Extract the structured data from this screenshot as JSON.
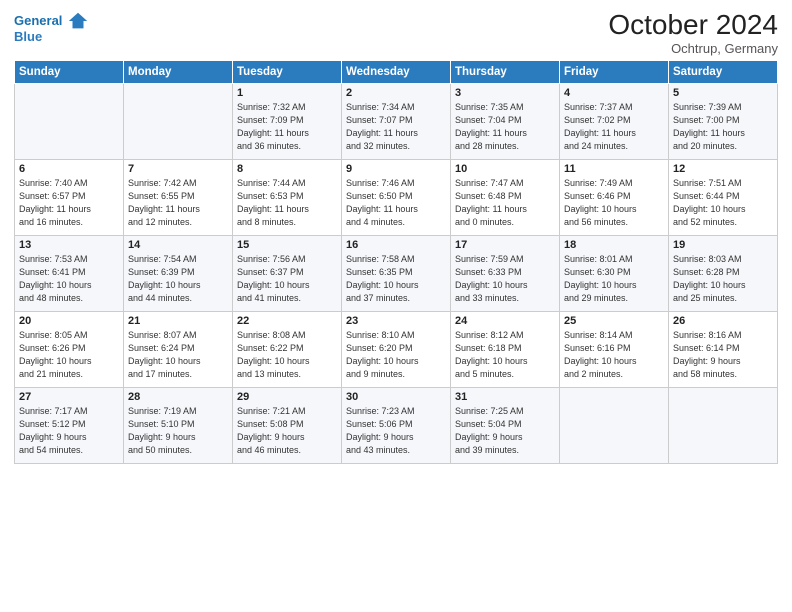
{
  "header": {
    "logo_line1": "General",
    "logo_line2": "Blue",
    "month": "October 2024",
    "location": "Ochtrup, Germany"
  },
  "days_of_week": [
    "Sunday",
    "Monday",
    "Tuesday",
    "Wednesday",
    "Thursday",
    "Friday",
    "Saturday"
  ],
  "weeks": [
    [
      {
        "day": "",
        "text": ""
      },
      {
        "day": "",
        "text": ""
      },
      {
        "day": "1",
        "text": "Sunrise: 7:32 AM\nSunset: 7:09 PM\nDaylight: 11 hours\nand 36 minutes."
      },
      {
        "day": "2",
        "text": "Sunrise: 7:34 AM\nSunset: 7:07 PM\nDaylight: 11 hours\nand 32 minutes."
      },
      {
        "day": "3",
        "text": "Sunrise: 7:35 AM\nSunset: 7:04 PM\nDaylight: 11 hours\nand 28 minutes."
      },
      {
        "day": "4",
        "text": "Sunrise: 7:37 AM\nSunset: 7:02 PM\nDaylight: 11 hours\nand 24 minutes."
      },
      {
        "day": "5",
        "text": "Sunrise: 7:39 AM\nSunset: 7:00 PM\nDaylight: 11 hours\nand 20 minutes."
      }
    ],
    [
      {
        "day": "6",
        "text": "Sunrise: 7:40 AM\nSunset: 6:57 PM\nDaylight: 11 hours\nand 16 minutes."
      },
      {
        "day": "7",
        "text": "Sunrise: 7:42 AM\nSunset: 6:55 PM\nDaylight: 11 hours\nand 12 minutes."
      },
      {
        "day": "8",
        "text": "Sunrise: 7:44 AM\nSunset: 6:53 PM\nDaylight: 11 hours\nand 8 minutes."
      },
      {
        "day": "9",
        "text": "Sunrise: 7:46 AM\nSunset: 6:50 PM\nDaylight: 11 hours\nand 4 minutes."
      },
      {
        "day": "10",
        "text": "Sunrise: 7:47 AM\nSunset: 6:48 PM\nDaylight: 11 hours\nand 0 minutes."
      },
      {
        "day": "11",
        "text": "Sunrise: 7:49 AM\nSunset: 6:46 PM\nDaylight: 10 hours\nand 56 minutes."
      },
      {
        "day": "12",
        "text": "Sunrise: 7:51 AM\nSunset: 6:44 PM\nDaylight: 10 hours\nand 52 minutes."
      }
    ],
    [
      {
        "day": "13",
        "text": "Sunrise: 7:53 AM\nSunset: 6:41 PM\nDaylight: 10 hours\nand 48 minutes."
      },
      {
        "day": "14",
        "text": "Sunrise: 7:54 AM\nSunset: 6:39 PM\nDaylight: 10 hours\nand 44 minutes."
      },
      {
        "day": "15",
        "text": "Sunrise: 7:56 AM\nSunset: 6:37 PM\nDaylight: 10 hours\nand 41 minutes."
      },
      {
        "day": "16",
        "text": "Sunrise: 7:58 AM\nSunset: 6:35 PM\nDaylight: 10 hours\nand 37 minutes."
      },
      {
        "day": "17",
        "text": "Sunrise: 7:59 AM\nSunset: 6:33 PM\nDaylight: 10 hours\nand 33 minutes."
      },
      {
        "day": "18",
        "text": "Sunrise: 8:01 AM\nSunset: 6:30 PM\nDaylight: 10 hours\nand 29 minutes."
      },
      {
        "day": "19",
        "text": "Sunrise: 8:03 AM\nSunset: 6:28 PM\nDaylight: 10 hours\nand 25 minutes."
      }
    ],
    [
      {
        "day": "20",
        "text": "Sunrise: 8:05 AM\nSunset: 6:26 PM\nDaylight: 10 hours\nand 21 minutes."
      },
      {
        "day": "21",
        "text": "Sunrise: 8:07 AM\nSunset: 6:24 PM\nDaylight: 10 hours\nand 17 minutes."
      },
      {
        "day": "22",
        "text": "Sunrise: 8:08 AM\nSunset: 6:22 PM\nDaylight: 10 hours\nand 13 minutes."
      },
      {
        "day": "23",
        "text": "Sunrise: 8:10 AM\nSunset: 6:20 PM\nDaylight: 10 hours\nand 9 minutes."
      },
      {
        "day": "24",
        "text": "Sunrise: 8:12 AM\nSunset: 6:18 PM\nDaylight: 10 hours\nand 5 minutes."
      },
      {
        "day": "25",
        "text": "Sunrise: 8:14 AM\nSunset: 6:16 PM\nDaylight: 10 hours\nand 2 minutes."
      },
      {
        "day": "26",
        "text": "Sunrise: 8:16 AM\nSunset: 6:14 PM\nDaylight: 9 hours\nand 58 minutes."
      }
    ],
    [
      {
        "day": "27",
        "text": "Sunrise: 7:17 AM\nSunset: 5:12 PM\nDaylight: 9 hours\nand 54 minutes."
      },
      {
        "day": "28",
        "text": "Sunrise: 7:19 AM\nSunset: 5:10 PM\nDaylight: 9 hours\nand 50 minutes."
      },
      {
        "day": "29",
        "text": "Sunrise: 7:21 AM\nSunset: 5:08 PM\nDaylight: 9 hours\nand 46 minutes."
      },
      {
        "day": "30",
        "text": "Sunrise: 7:23 AM\nSunset: 5:06 PM\nDaylight: 9 hours\nand 43 minutes."
      },
      {
        "day": "31",
        "text": "Sunrise: 7:25 AM\nSunset: 5:04 PM\nDaylight: 9 hours\nand 39 minutes."
      },
      {
        "day": "",
        "text": ""
      },
      {
        "day": "",
        "text": ""
      }
    ]
  ]
}
